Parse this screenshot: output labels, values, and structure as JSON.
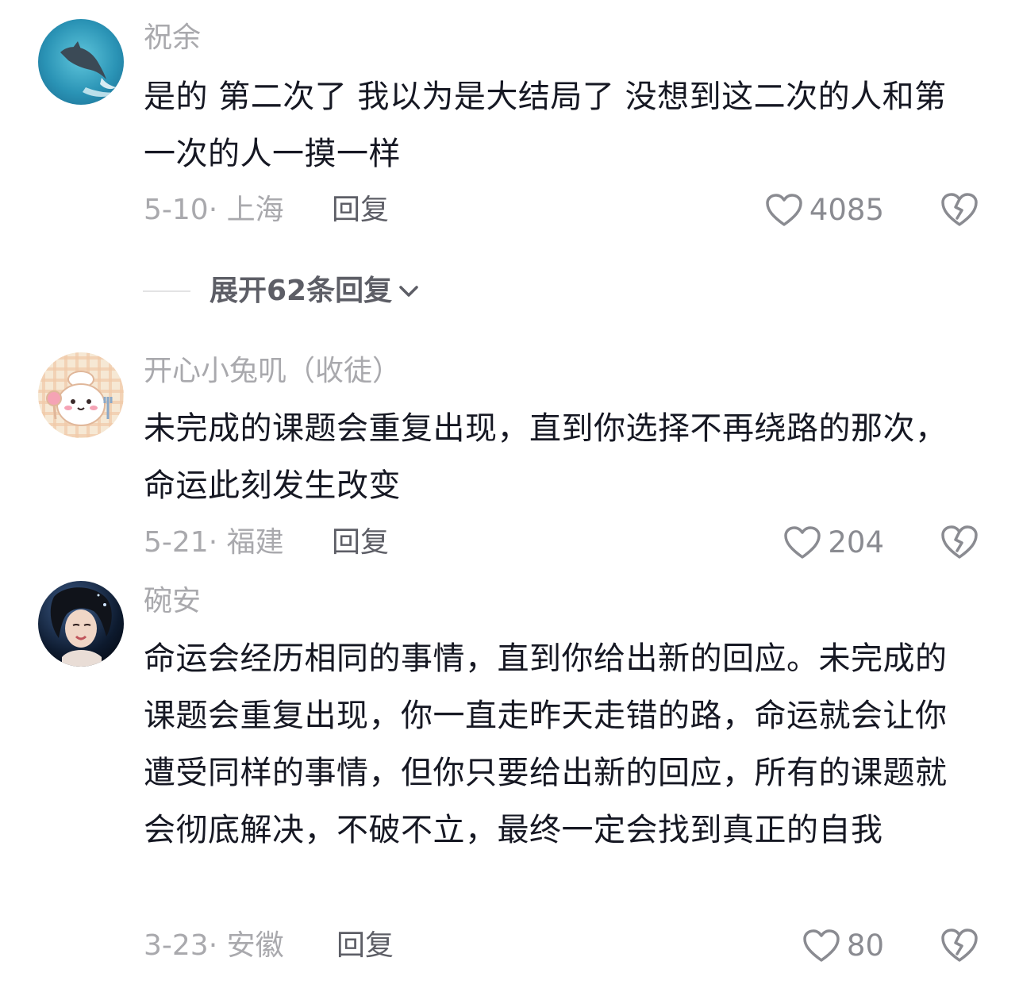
{
  "comments": [
    {
      "username": "祝余",
      "avatar": "dolphin-ocean-avatar",
      "text": "是的 第二次了 我以为是大结局了 没想到这二次的人和第一次的人一摸一样",
      "date": "5-10",
      "location": "上海",
      "reply_label": "回复",
      "likes": "4085"
    },
    {
      "username": "开心小兔叽（收徒）",
      "avatar": "cartoon-chef-bunny-avatar",
      "text": "未完成的课题会重复出现，直到你选择不再绕路的那次，命运此刻发生改变",
      "date": "5-21",
      "location": "福建",
      "reply_label": "回复",
      "likes": "204"
    },
    {
      "username": "碗安",
      "avatar": "girl-photo-avatar",
      "text": "命运会经历相同的事情，直到你给出新的回应。未完成的课题会重复出现，你一直走昨天走错的路，命运就会让你遭受同样的事情，但你只要给出新的回应，所有的课题就会彻底解决，不破不立，最终一定会找到真正的自我",
      "date": "3-23",
      "location": "安徽",
      "reply_label": "回复",
      "likes": "80"
    }
  ],
  "expand_replies": {
    "label": "展开62条回复"
  },
  "meta_separator": "·",
  "colors": {
    "text": "#161823",
    "muted": "#a9a9ad",
    "secondary": "#5d5e66",
    "icon": "#8a8b91"
  }
}
